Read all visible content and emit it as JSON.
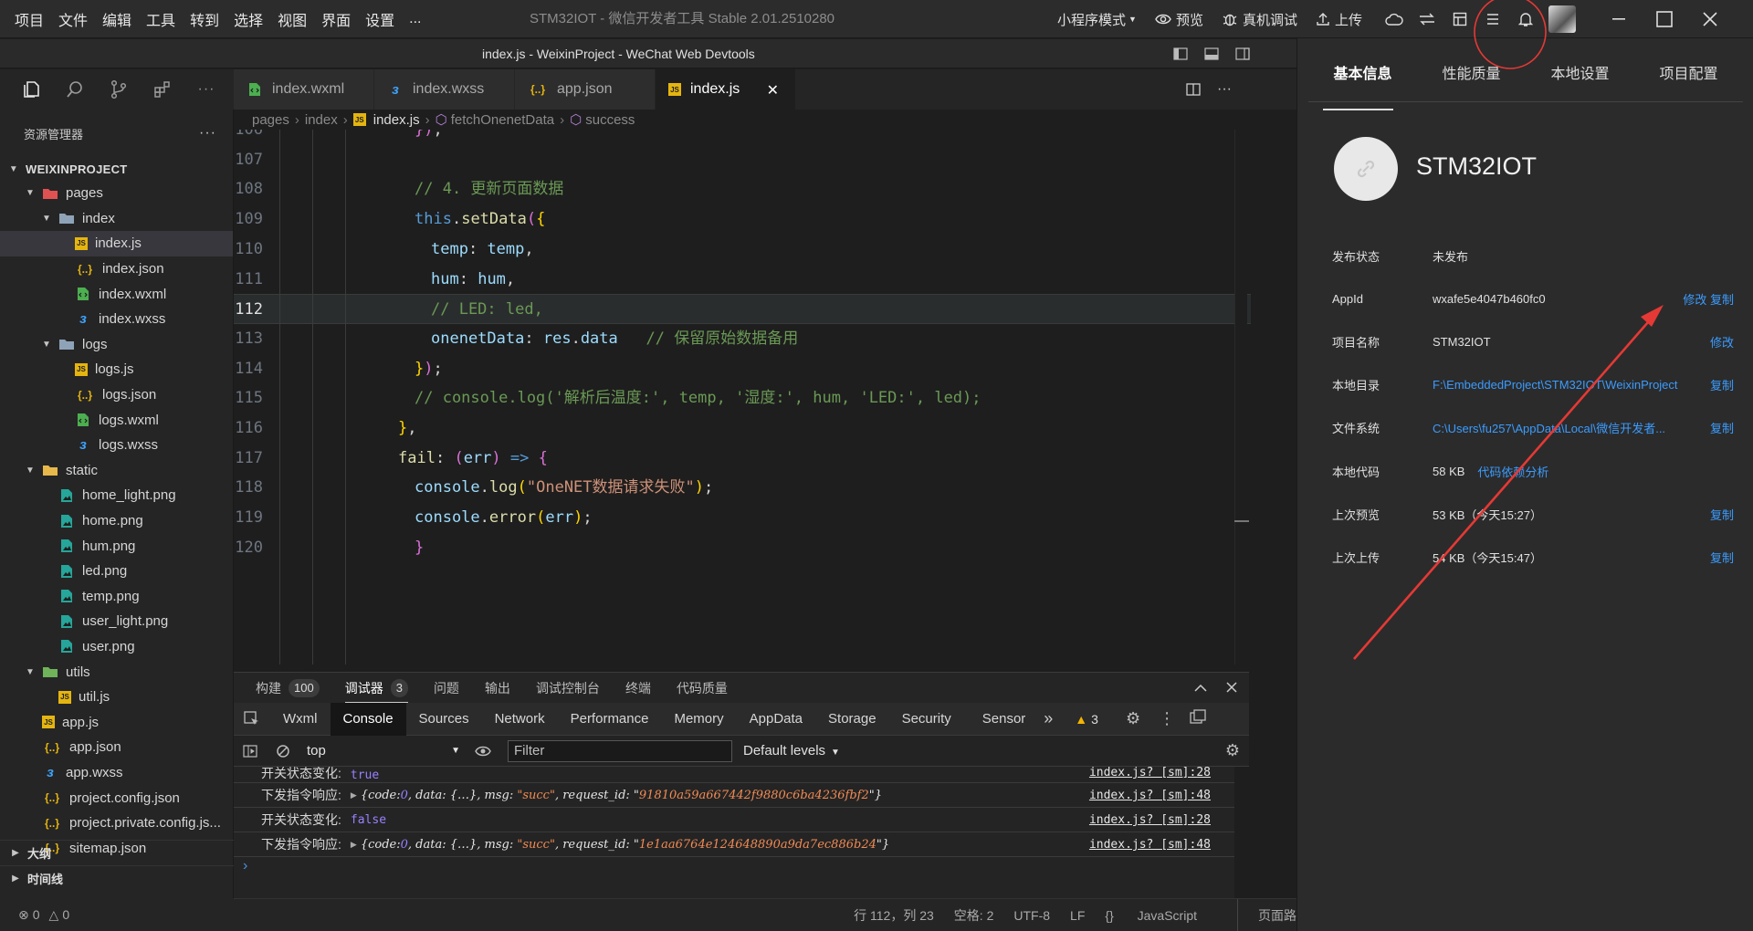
{
  "menus": [
    "项目",
    "文件",
    "编辑",
    "工具",
    "转到",
    "选择",
    "视图",
    "界面",
    "设置",
    "..."
  ],
  "app_title": "STM32IOT - 微信开发者工具 Stable 2.01.2510280",
  "toolbar": {
    "mode": "小程序模式",
    "preview": "预览",
    "remote_debug": "真机调试",
    "upload": "上传"
  },
  "window_title": "index.js - WeixinProject - WeChat Web Devtools",
  "explorer": {
    "title": "资源管理器",
    "project": "WEIXINPROJECT",
    "outline": "大纲",
    "timeline": "时间线",
    "errors": "0",
    "warnings": "0"
  },
  "tree": [
    {
      "label": "pages",
      "depth": 1,
      "kind": "folder-red",
      "open": true
    },
    {
      "label": "index",
      "depth": 2,
      "kind": "folder",
      "open": true
    },
    {
      "label": "index.js",
      "depth": 3,
      "kind": "js",
      "selected": true
    },
    {
      "label": "index.json",
      "depth": 3,
      "kind": "json"
    },
    {
      "label": "index.wxml",
      "depth": 3,
      "kind": "wxml"
    },
    {
      "label": "index.wxss",
      "depth": 3,
      "kind": "wxss"
    },
    {
      "label": "logs",
      "depth": 2,
      "kind": "folder",
      "open": true
    },
    {
      "label": "logs.js",
      "depth": 3,
      "kind": "js"
    },
    {
      "label": "logs.json",
      "depth": 3,
      "kind": "json"
    },
    {
      "label": "logs.wxml",
      "depth": 3,
      "kind": "wxml"
    },
    {
      "label": "logs.wxss",
      "depth": 3,
      "kind": "wxss"
    },
    {
      "label": "static",
      "depth": 1,
      "kind": "folder-yellow",
      "open": true
    },
    {
      "label": "home_light.png",
      "depth": 2,
      "kind": "png"
    },
    {
      "label": "home.png",
      "depth": 2,
      "kind": "png"
    },
    {
      "label": "hum.png",
      "depth": 2,
      "kind": "png"
    },
    {
      "label": "led.png",
      "depth": 2,
      "kind": "png"
    },
    {
      "label": "temp.png",
      "depth": 2,
      "kind": "png"
    },
    {
      "label": "user_light.png",
      "depth": 2,
      "kind": "png"
    },
    {
      "label": "user.png",
      "depth": 2,
      "kind": "png"
    },
    {
      "label": "utils",
      "depth": 1,
      "kind": "folder-green",
      "open": true
    },
    {
      "label": "util.js",
      "depth": 2,
      "kind": "js"
    },
    {
      "label": "app.js",
      "depth": 1,
      "kind": "js",
      "nochev": true
    },
    {
      "label": "app.json",
      "depth": 1,
      "kind": "json",
      "nochev": true
    },
    {
      "label": "app.wxss",
      "depth": 1,
      "kind": "wxss",
      "nochev": true
    },
    {
      "label": "project.config.json",
      "depth": 1,
      "kind": "json",
      "nochev": true
    },
    {
      "label": "project.private.config.js...",
      "depth": 1,
      "kind": "json",
      "nochev": true
    },
    {
      "label": "sitemap.json",
      "depth": 1,
      "kind": "json",
      "nochev": true
    }
  ],
  "tabs": [
    {
      "label": "index.wxml",
      "kind": "wxml"
    },
    {
      "label": "index.wxss",
      "kind": "wxss"
    },
    {
      "label": "app.json",
      "kind": "json"
    },
    {
      "label": "index.js",
      "kind": "js",
      "active": true
    }
  ],
  "breadcrumb": [
    "pages",
    "index",
    "index.js",
    "fetchOnenetData",
    "success"
  ],
  "code": [
    {
      "n": "106",
      "indent": 4,
      "tokens": [
        [
          "br2",
          "})"
        ],
        [
          "pn",
          ";"
        ]
      ]
    },
    {
      "n": "107",
      "indent": 0,
      "tokens": []
    },
    {
      "n": "108",
      "indent": 4,
      "tokens": [
        [
          "c",
          "// 4. 更新页面数据"
        ]
      ]
    },
    {
      "n": "109",
      "indent": 4,
      "tokens": [
        [
          "k",
          "this"
        ],
        [
          "pn",
          "."
        ],
        [
          "f",
          "setData"
        ],
        [
          "br2",
          "("
        ],
        [
          "br",
          "{"
        ]
      ]
    },
    {
      "n": "110",
      "indent": 5,
      "tokens": [
        [
          "p",
          "temp"
        ],
        [
          "pn",
          ": "
        ],
        [
          "v",
          "temp"
        ],
        [
          "pn",
          ","
        ]
      ]
    },
    {
      "n": "111",
      "indent": 5,
      "tokens": [
        [
          "p",
          "hum"
        ],
        [
          "pn",
          ": "
        ],
        [
          "v",
          "hum"
        ],
        [
          "pn",
          ","
        ]
      ]
    },
    {
      "n": "112",
      "indent": 5,
      "tokens": [
        [
          "c",
          "// LED: led,"
        ]
      ],
      "current": true
    },
    {
      "n": "113",
      "indent": 5,
      "tokens": [
        [
          "p",
          "onenetData"
        ],
        [
          "pn",
          ": "
        ],
        [
          "v",
          "res"
        ],
        [
          "pn",
          "."
        ],
        [
          "v",
          "data"
        ],
        [
          "pn",
          "   "
        ],
        [
          "c",
          "// 保留原始数据备用"
        ]
      ]
    },
    {
      "n": "114",
      "indent": 4,
      "tokens": [
        [
          "br",
          "}"
        ],
        [
          "br2",
          ")"
        ],
        [
          "pn",
          ";"
        ]
      ]
    },
    {
      "n": "115",
      "indent": 4,
      "tokens": [
        [
          "c",
          "// console.log('解析后温度:', temp, '湿度:', hum, 'LED:', led);"
        ]
      ]
    },
    {
      "n": "116",
      "indent": 3,
      "tokens": [
        [
          "br",
          "}"
        ],
        [
          "pn",
          ","
        ]
      ]
    },
    {
      "n": "117",
      "indent": 3,
      "tokens": [
        [
          "f",
          "fail"
        ],
        [
          "pn",
          ": "
        ],
        [
          "br2",
          "("
        ],
        [
          "v",
          "err"
        ],
        [
          "br2",
          ")"
        ],
        [
          "k",
          " =>"
        ],
        [
          "br2",
          " {"
        ]
      ]
    },
    {
      "n": "118",
      "indent": 4,
      "tokens": [
        [
          "v",
          "console"
        ],
        [
          "pn",
          "."
        ],
        [
          "f",
          "log"
        ],
        [
          "br",
          "("
        ],
        [
          "s",
          "\"OneNET数据请求失败\""
        ],
        [
          "br",
          ")"
        ],
        [
          "pn",
          ";"
        ]
      ]
    },
    {
      "n": "119",
      "indent": 4,
      "tokens": [
        [
          "v",
          "console"
        ],
        [
          "pn",
          "."
        ],
        [
          "f",
          "error"
        ],
        [
          "br",
          "("
        ],
        [
          "v",
          "err"
        ],
        [
          "br",
          ")"
        ],
        [
          "pn",
          ";"
        ]
      ]
    },
    {
      "n": "120",
      "indent": 4,
      "tokens": [
        [
          "br2",
          "}"
        ]
      ]
    }
  ],
  "panel_tabs": [
    {
      "label": "构建",
      "badge": "100"
    },
    {
      "label": "调试器",
      "badge": "3",
      "active": true
    },
    {
      "label": "问题"
    },
    {
      "label": "输出"
    },
    {
      "label": "调试控制台"
    },
    {
      "label": "终端"
    },
    {
      "label": "代码质量"
    }
  ],
  "devtools_tabs": [
    "Wxml",
    "Console",
    "Sources",
    "Network",
    "Performance",
    "Memory",
    "AppData",
    "Storage",
    "Security",
    "Sensor"
  ],
  "devtools_active": "Console",
  "warnings_count": "3",
  "console_bar": {
    "context": "top",
    "filter_placeholder": "Filter",
    "levels": "Default levels"
  },
  "console": [
    {
      "label": "开关状态变化:",
      "type": "bool",
      "value": "true",
      "src": "index.js? [sm]:28",
      "partial": true
    },
    {
      "label": "下发指令响应:",
      "type": "obj",
      "request_id": "91810a59a667442f9880c6ba4236fbf2",
      "src": "index.js? [sm]:48"
    },
    {
      "label": "开关状态变化:",
      "type": "bool",
      "value": "false",
      "src": "index.js? [sm]:28"
    },
    {
      "label": "下发指令响应:",
      "type": "obj",
      "request_id": "1e1aa6764e124648890a9da7ec886b24",
      "src": "index.js? [sm]:48"
    }
  ],
  "console_obj": {
    "open": "{",
    "code_key": "code",
    "code_val": "0",
    "data_key": "data",
    "data_val": "{…}",
    "msg_key": "msg",
    "msg_val": "\"succ\"",
    "rid_key": "request_id"
  },
  "status": {
    "cursor": "行 112，列 23",
    "spaces": "空格: 2",
    "encoding": "UTF-8",
    "eol": "LF",
    "lang": "JavaScript",
    "extra": "页面路"
  },
  "details": {
    "tabs": [
      "基本信息",
      "性能质量",
      "本地设置",
      "项目配置"
    ],
    "app_name": "STM32IOT",
    "rows": [
      {
        "k": "发布状态",
        "v": "未发布"
      },
      {
        "k": "AppId",
        "v": "wxafe5e4047b460fc0",
        "action": "修改 复制"
      },
      {
        "k": "项目名称",
        "v": "STM32IOT",
        "action": "修改"
      },
      {
        "k": "本地目录",
        "link": "F:\\EmbeddedProject\\STM32IOT\\WeixinProject",
        "action": "复制"
      },
      {
        "k": "文件系统",
        "link": "C:\\Users\\fu257\\AppData\\Local\\微信开发者...",
        "action": "复制"
      },
      {
        "k": "本地代码",
        "v": "58 KB",
        "link": "代码依赖分析"
      },
      {
        "k": "上次预览",
        "v": "53 KB（今天15:27）",
        "action": "复制"
      },
      {
        "k": "上次上传",
        "v": "54 KB（今天15:47）",
        "action": "复制"
      }
    ]
  },
  "colors": {
    "accent": "#3b9cff",
    "annotation": "#e53935",
    "bg": "#1e1e1e"
  }
}
